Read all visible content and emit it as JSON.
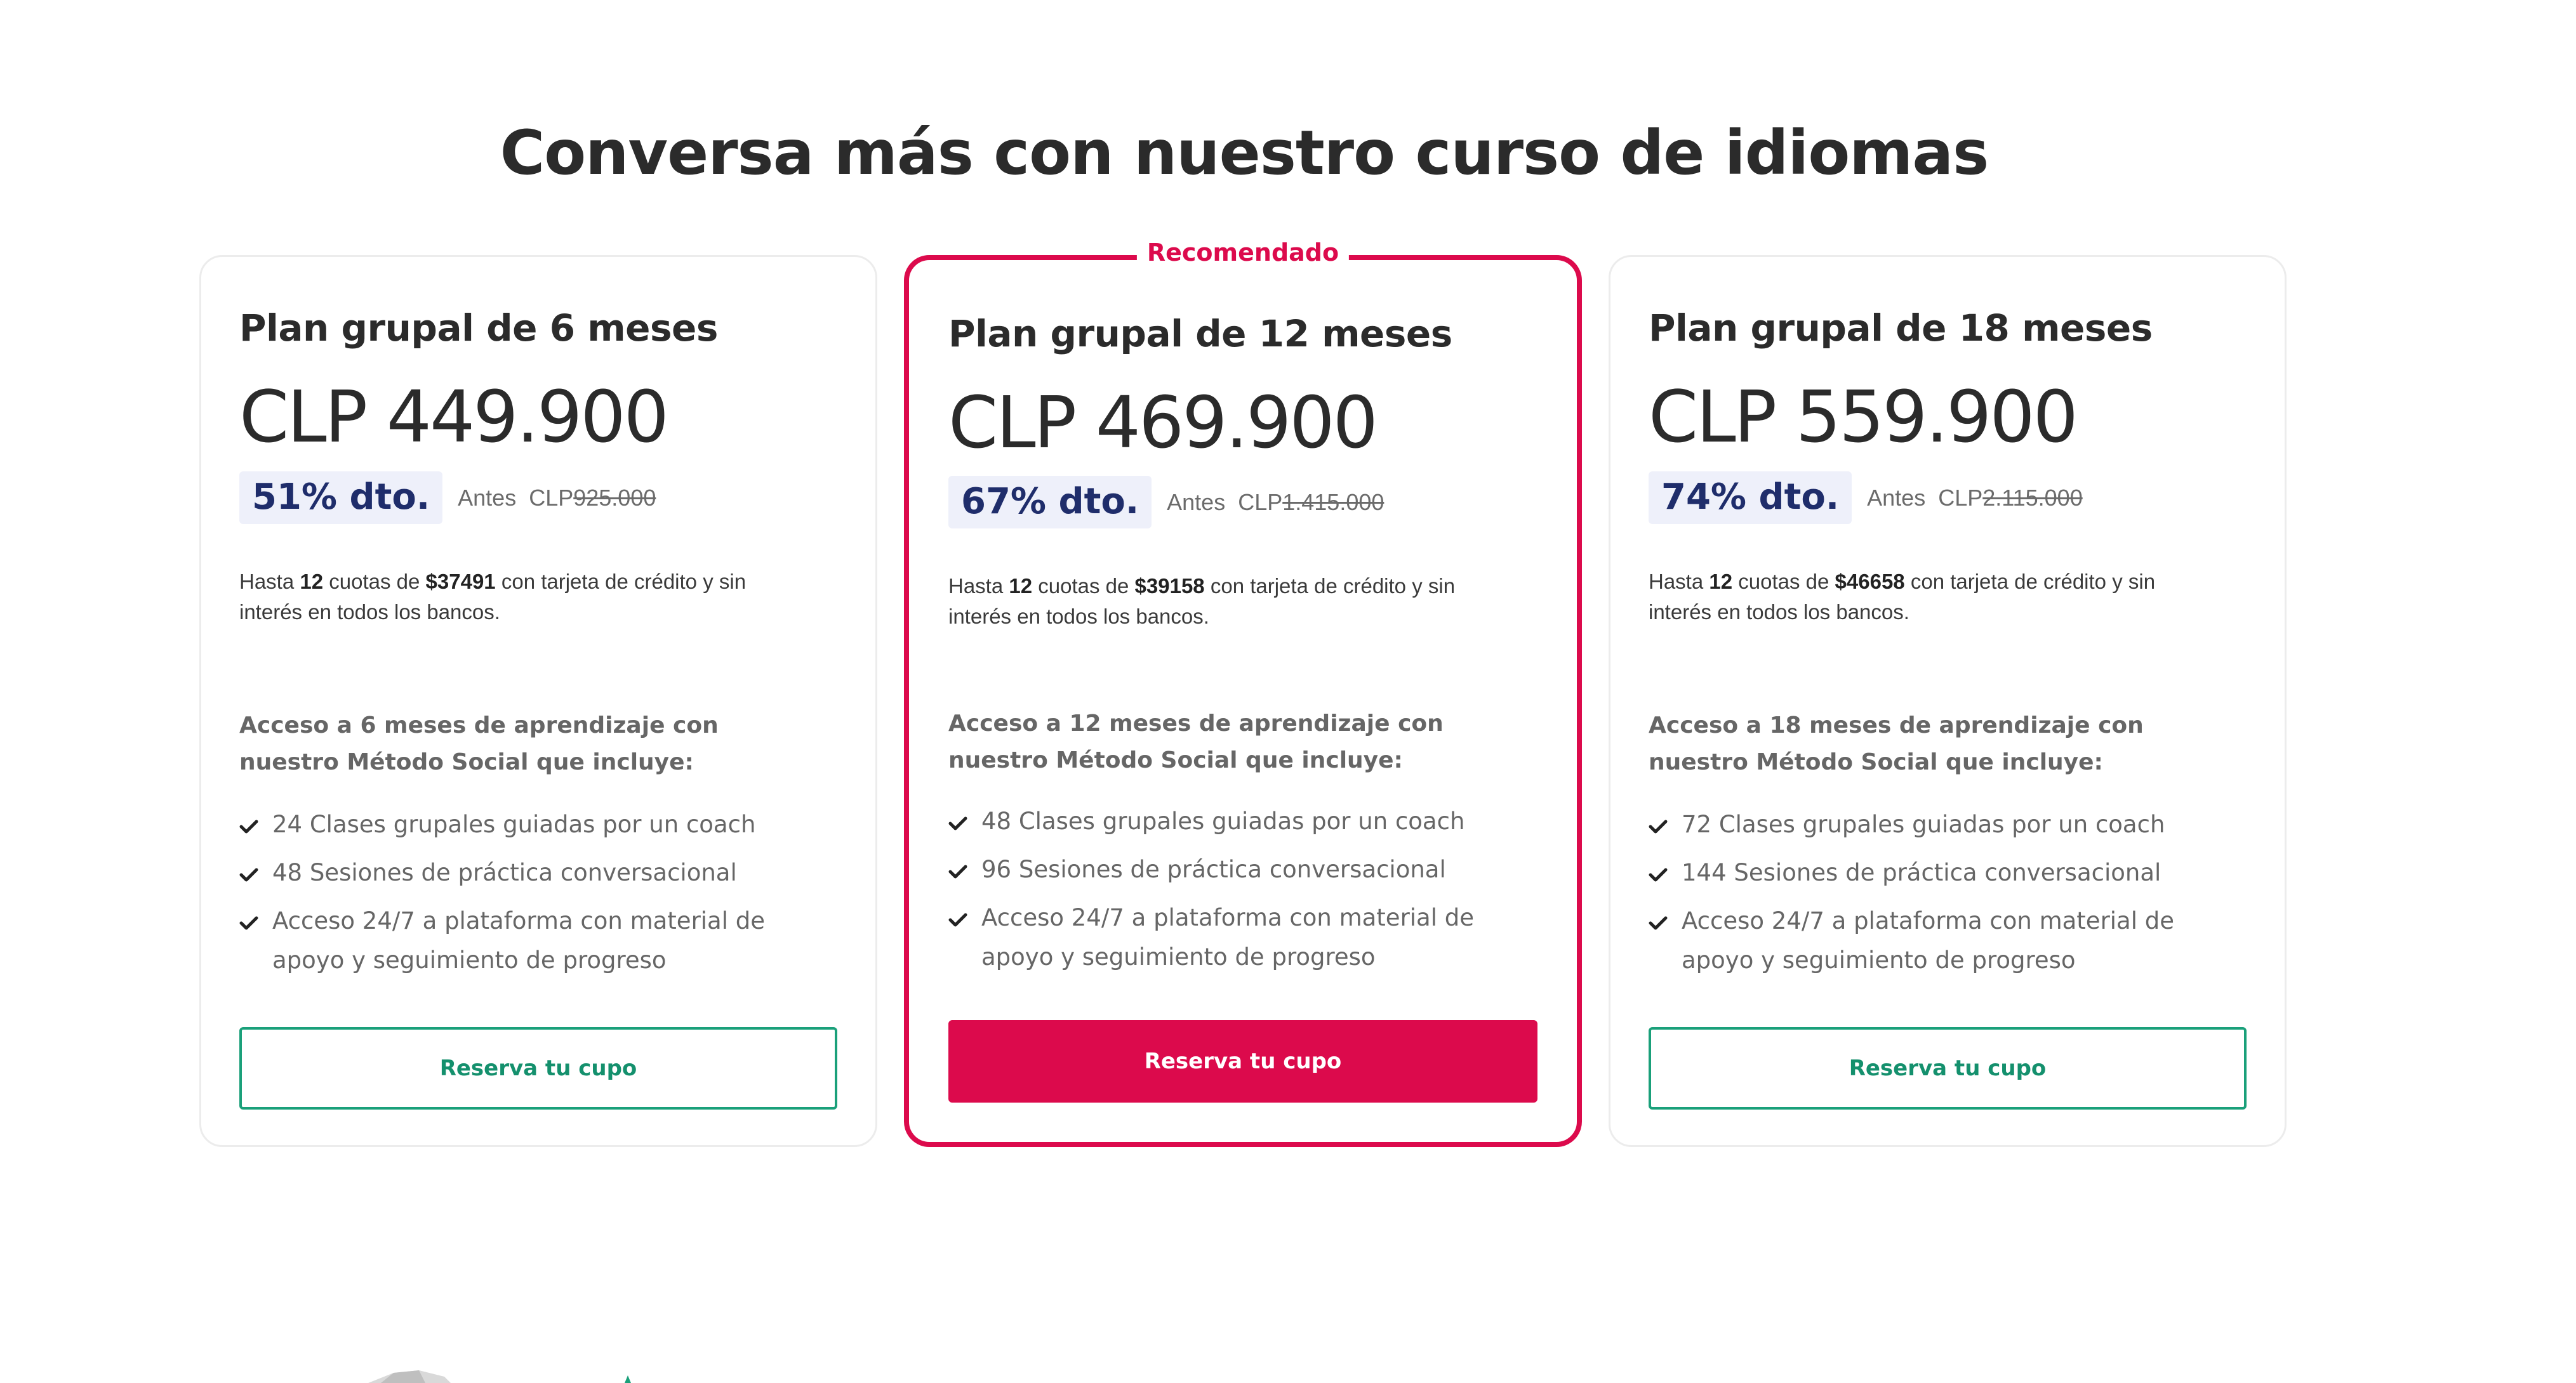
{
  "title": "Conversa más con nuestro curso de idiomas",
  "colors": {
    "accent": "#dc0a4c",
    "secondary": "#1aa07a",
    "badge_bg": "#eef0fa",
    "badge_text": "#1f2d6b"
  },
  "plans": [
    {
      "name": "Plan grupal de 6 meses",
      "price": "CLP 449.900",
      "discount": "51% dto.",
      "before_label": "Antes",
      "before_currency": "CLP",
      "before_amount": "925.000",
      "installments": {
        "pre": "Hasta ",
        "count": "12",
        "mid": " cuotas de ",
        "amount": "$37491",
        "post": " con tarjeta de crédito y sin interés en todos los bancos."
      },
      "access": "Acceso a 6 meses de aprendizaje con nuestro Método Social que incluye:",
      "features": [
        "24 Clases grupales guiadas por un coach",
        "48 Sesiones de práctica conversacional",
        "Acceso 24/7 a plataforma con material de apoyo y seguimiento de progreso"
      ],
      "cta": "Reserva tu cupo"
    },
    {
      "recommended_label": "Recomendado",
      "name": "Plan grupal de 12 meses",
      "price": "CLP 469.900",
      "discount": "67% dto.",
      "before_label": "Antes",
      "before_currency": "CLP",
      "before_amount": "1.415.000",
      "installments": {
        "pre": "Hasta ",
        "count": "12",
        "mid": " cuotas de ",
        "amount": "$39158",
        "post": " con tarjeta de crédito y sin interés en todos los bancos."
      },
      "access": "Acceso a 12 meses de aprendizaje con nuestro Método Social que incluye:",
      "features": [
        "48 Clases grupales guiadas por un coach",
        "96 Sesiones de práctica conversacional",
        "Acceso 24/7 a plataforma con material de apoyo y seguimiento de progreso"
      ],
      "cta": "Reserva tu cupo"
    },
    {
      "name": "Plan grupal de 18 meses",
      "price": "CLP 559.900",
      "discount": "74% dto.",
      "before_label": "Antes",
      "before_currency": "CLP",
      "before_amount": "2.115.000",
      "installments": {
        "pre": "Hasta ",
        "count": "12",
        "mid": " cuotas de ",
        "amount": "$46658",
        "post": " con tarjeta de crédito y sin interés en todos los bancos."
      },
      "access": "Acceso a 18 meses de aprendizaje con nuestro Método Social que incluye:",
      "features": [
        "72 Clases grupales guiadas por un coach",
        "144 Sesiones de práctica conversacional",
        "Acceso 24/7 a plataforma con material de apoyo y seguimiento de progreso"
      ],
      "cta": "Reserva tu cupo"
    }
  ]
}
